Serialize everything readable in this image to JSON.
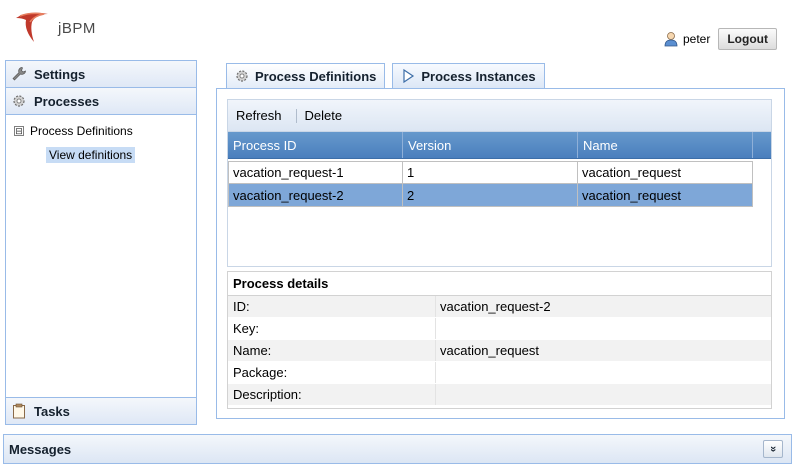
{
  "app": {
    "logo_text": "jBPM"
  },
  "header": {
    "user_name": "peter",
    "logout_label": "Logout"
  },
  "nav": {
    "settings_label": "Settings",
    "processes_label": "Processes",
    "tree": {
      "group_label": "Process Definitions",
      "group_expander": "⊟",
      "child_label": "View definitions"
    },
    "tasks_label": "Tasks"
  },
  "tabs": [
    {
      "label": "Process Definitions",
      "active": true
    },
    {
      "label": "Process Instances",
      "active": false
    }
  ],
  "toolbar": {
    "refresh_label": "Refresh",
    "delete_label": "Delete"
  },
  "grid": {
    "columns": [
      "Process ID",
      "Version",
      "Name"
    ],
    "rows": [
      {
        "id": "vacation_request-1",
        "version": "1",
        "name": "vacation_request",
        "selected": false
      },
      {
        "id": "vacation_request-2",
        "version": "2",
        "name": "vacation_request",
        "selected": true
      }
    ]
  },
  "details": {
    "title": "Process details",
    "fields": [
      {
        "label": "ID:",
        "value": "vacation_request-2"
      },
      {
        "label": "Key:",
        "value": ""
      },
      {
        "label": "Name:",
        "value": "vacation_request"
      },
      {
        "label": "Package:",
        "value": ""
      },
      {
        "label": "Description:",
        "value": ""
      }
    ]
  },
  "messages": {
    "label": "Messages",
    "toggle_glyph": "»"
  },
  "colors": {
    "accent_border": "#99bbe8",
    "grid_header": "#5a8cc6",
    "selected_row": "#7ea7d8",
    "logo_red": "#c0392b"
  },
  "icons": {
    "logo": "jbpm-swoosh-icon",
    "user": "user-icon",
    "settings": "wrench-icon",
    "processes": "gear-icon",
    "tasks": "clipboard-icon",
    "tab_definitions": "gear-icon",
    "tab_instances": "play-arrow-icon",
    "messages_toggle": "double-chevron-down-icon"
  }
}
